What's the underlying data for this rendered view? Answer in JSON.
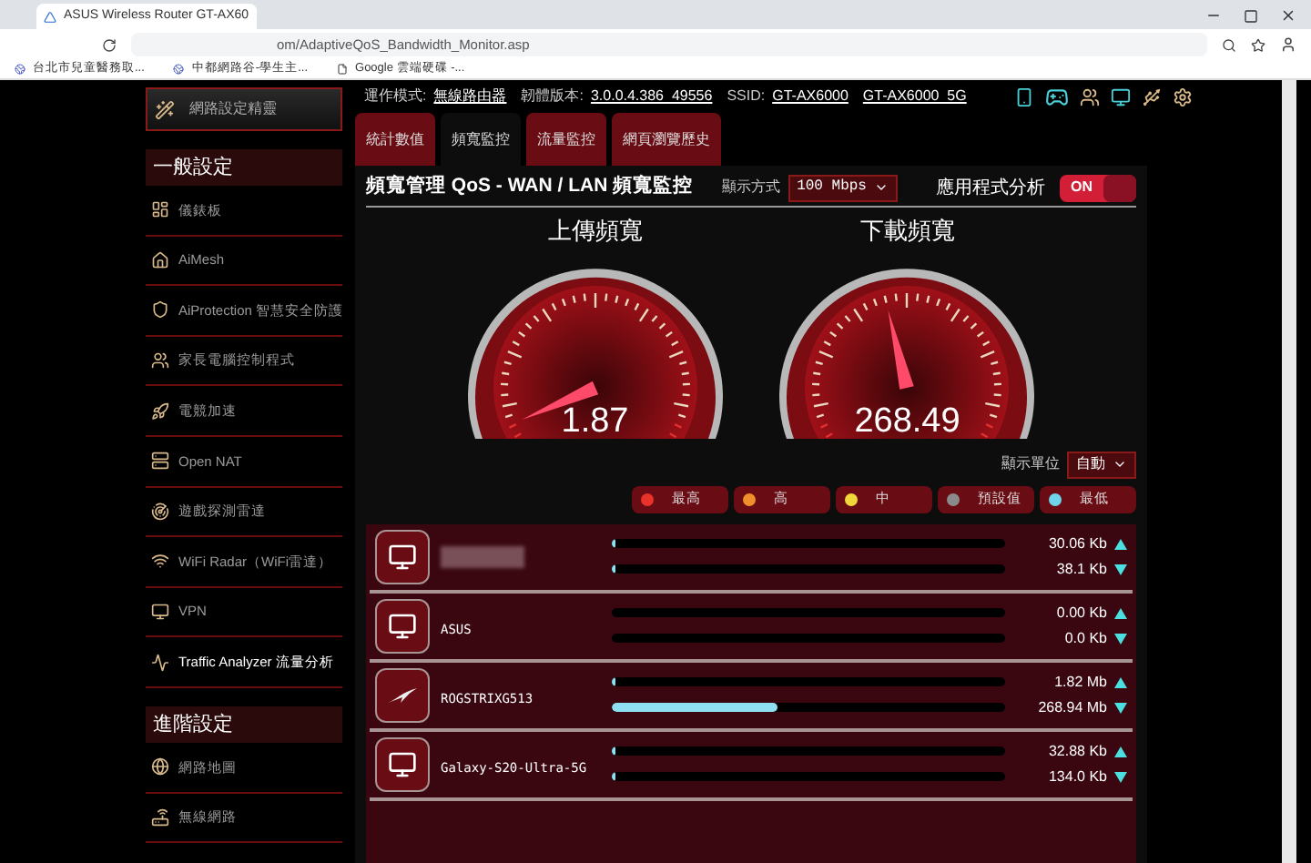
{
  "browser": {
    "tab_title": "ASUS Wireless Router GT-AX60",
    "url": "om/AdaptiveQoS_Bandwidth_Monitor.asp",
    "bookmarks": [
      "台北市兒童醫務取...",
      "中都網路谷-學生主...",
      "Google 雲端硬碟 -..."
    ]
  },
  "status": {
    "mode_label": "運作模式:",
    "mode": "無線路由器",
    "fw_label": "韌體版本:",
    "fw": "3.0.0.4.386_49556",
    "ssid_label": "SSID:",
    "ssids": [
      "GT-AX6000",
      "GT-AX6000_5G"
    ]
  },
  "sidebar": {
    "wizard": "網路設定精靈",
    "sections": [
      {
        "title": "一般設定",
        "items": [
          {
            "label": "儀錶板",
            "selected": false
          },
          {
            "label": "AiMesh",
            "selected": false
          },
          {
            "label": "AiProtection 智慧安全防護",
            "selected": false
          },
          {
            "label": "家長電腦控制程式",
            "selected": false
          },
          {
            "label": "電競加速",
            "selected": false
          },
          {
            "label": "Open NAT",
            "selected": false
          },
          {
            "label": "遊戲探測雷達",
            "selected": false
          },
          {
            "label": "WiFi Radar（WiFi雷達）",
            "selected": false
          },
          {
            "label": "VPN",
            "selected": false
          },
          {
            "label": "Traffic Analyzer 流量分析",
            "selected": true
          }
        ]
      },
      {
        "title": "進階設定",
        "items": [
          {
            "label": "網路地圖",
            "selected": false
          },
          {
            "label": "無線網路",
            "selected": false
          }
        ]
      }
    ]
  },
  "tabs": [
    {
      "label": "統計數值",
      "selected": false
    },
    {
      "label": "頻寬監控",
      "selected": true
    },
    {
      "label": "流量監控",
      "selected": false
    },
    {
      "label": "網頁瀏覽歷史",
      "selected": false
    }
  ],
  "header": {
    "title": "頻寬管理 QoS - WAN / LAN 頻寬監控",
    "display_label": "顯示方式",
    "display_value": "100 Mbps",
    "app_analysis_label": "應用程式分析",
    "app_analysis_on": true,
    "on_text": "ON"
  },
  "gauges": [
    {
      "title": "上傳頻寬",
      "reading": "1.87"
    },
    {
      "title": "下載頻寬",
      "reading": "268.49"
    }
  ],
  "unit": {
    "label": "顯示單位",
    "value": "自動"
  },
  "legend": [
    {
      "label": "最高",
      "color": "#e8322a"
    },
    {
      "label": "高",
      "color": "#f0902a"
    },
    {
      "label": "中",
      "color": "#f0d83a"
    },
    {
      "label": "預設值",
      "color": "#8a8a8a"
    },
    {
      "label": "最低",
      "color": "#6fd3ea"
    }
  ],
  "devices": [
    {
      "kind": "pc",
      "up": {
        "level": 0.005,
        "reading": "30.06 Kb"
      },
      "down": {
        "level": 0.005,
        "reading": "38.1 Kb"
      }
    },
    {
      "kind": "pc",
      "name": "ASUS",
      "up": {
        "level": 0,
        "reading": "0.00 Kb"
      },
      "down": {
        "level": 0,
        "reading": "0.0 Kb"
      }
    },
    {
      "kind": "rog",
      "name": "ROGSTRIXG513",
      "up": {
        "level": 0.005,
        "reading": "1.82 Mb"
      },
      "down": {
        "level": 0.42,
        "reading": "268.94 Mb"
      }
    },
    {
      "kind": "pc",
      "name": "Galaxy-S20-Ultra-5G",
      "up": {
        "level": 0.005,
        "reading": "32.88 Kb"
      },
      "down": {
        "level": 0.005,
        "reading": "134.0 Kb"
      }
    }
  ]
}
